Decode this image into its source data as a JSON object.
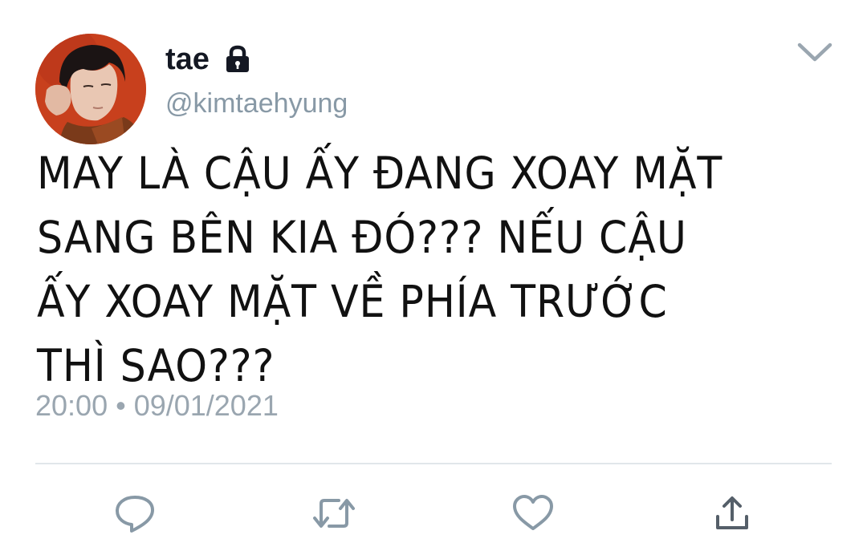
{
  "tweet": {
    "display_name": "tae",
    "handle": "@kimtaehyung",
    "text": "MAY LÀ CẬU ẤY ĐANG XOAY MẶT\nSANG BÊN KIA ĐÓ??? NẾU CẬU\nẤY XOAY MẶT VỀ PHÍA TRƯỚC\nTHÌ SAO???",
    "timestamp": "20:00 • 09/01/2021",
    "protected": true,
    "icons": {
      "lock": "lock-icon",
      "menu": "chevron-down-icon",
      "reply": "reply-icon",
      "retweet": "retweet-icon",
      "like": "heart-icon",
      "share": "share-icon"
    }
  },
  "colors": {
    "text": "#111111",
    "secondary": "#8899a6",
    "divider": "#e1e6ea",
    "icon": "#8899a6"
  }
}
